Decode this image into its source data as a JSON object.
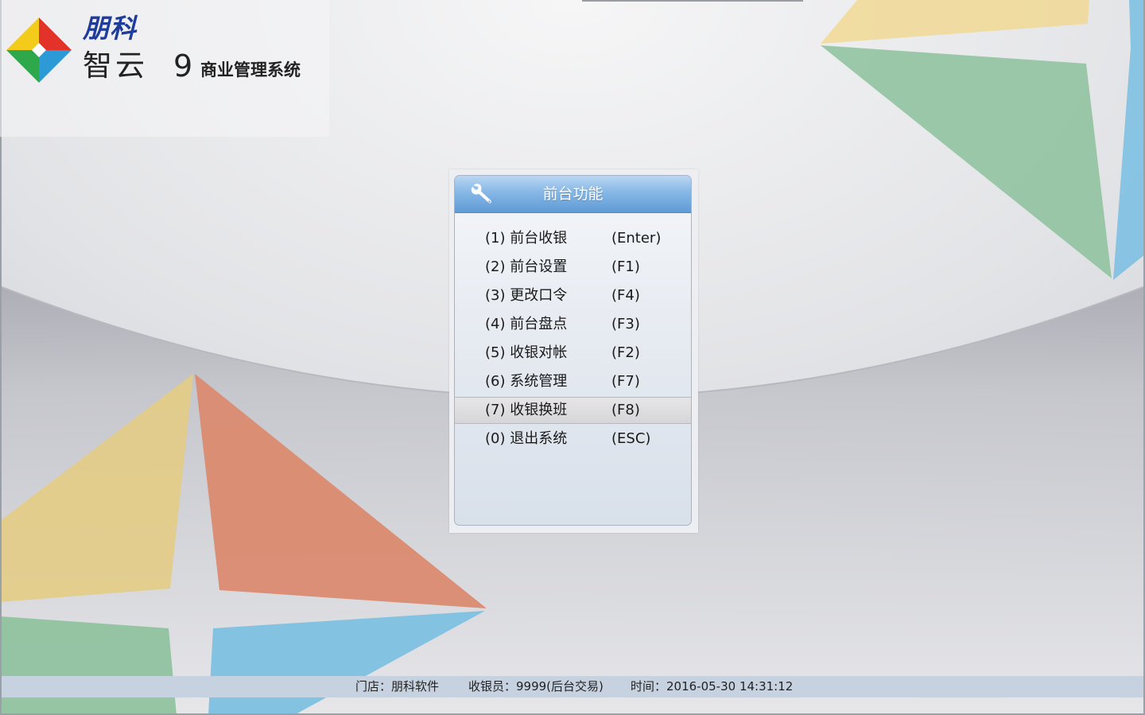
{
  "logo": {
    "company": "朋科",
    "product": "智云",
    "version": "9",
    "subtitle": "商业管理系统"
  },
  "menu": {
    "title": "前台功能",
    "icon": "wrench-icon",
    "selected_index": 6,
    "items": [
      {
        "label": "(1) 前台收银",
        "key": "(Enter)"
      },
      {
        "label": "(2) 前台设置",
        "key": "(F1)"
      },
      {
        "label": "(3) 更改口令",
        "key": "(F4)"
      },
      {
        "label": "(4) 前台盘点",
        "key": "(F3)"
      },
      {
        "label": "(5) 收银对帐",
        "key": "(F2)"
      },
      {
        "label": "(6) 系统管理",
        "key": "(F7)"
      },
      {
        "label": "(7) 收银换班",
        "key": "(F8)"
      },
      {
        "label": "(0) 退出系统",
        "key": "(ESC)"
      }
    ]
  },
  "status": {
    "store": "门店：朋科软件",
    "cashier": "收银员：9999(后台交易)",
    "time": "时间：2016-05-30 14:31:12"
  },
  "colors": {
    "header_blue": "#6fa6dc",
    "status_bar": "#c7d2e0",
    "yellow": "#e3cc85",
    "orange": "#da8b70",
    "green": "#8cc19b",
    "blue": "#7ec0e2"
  }
}
